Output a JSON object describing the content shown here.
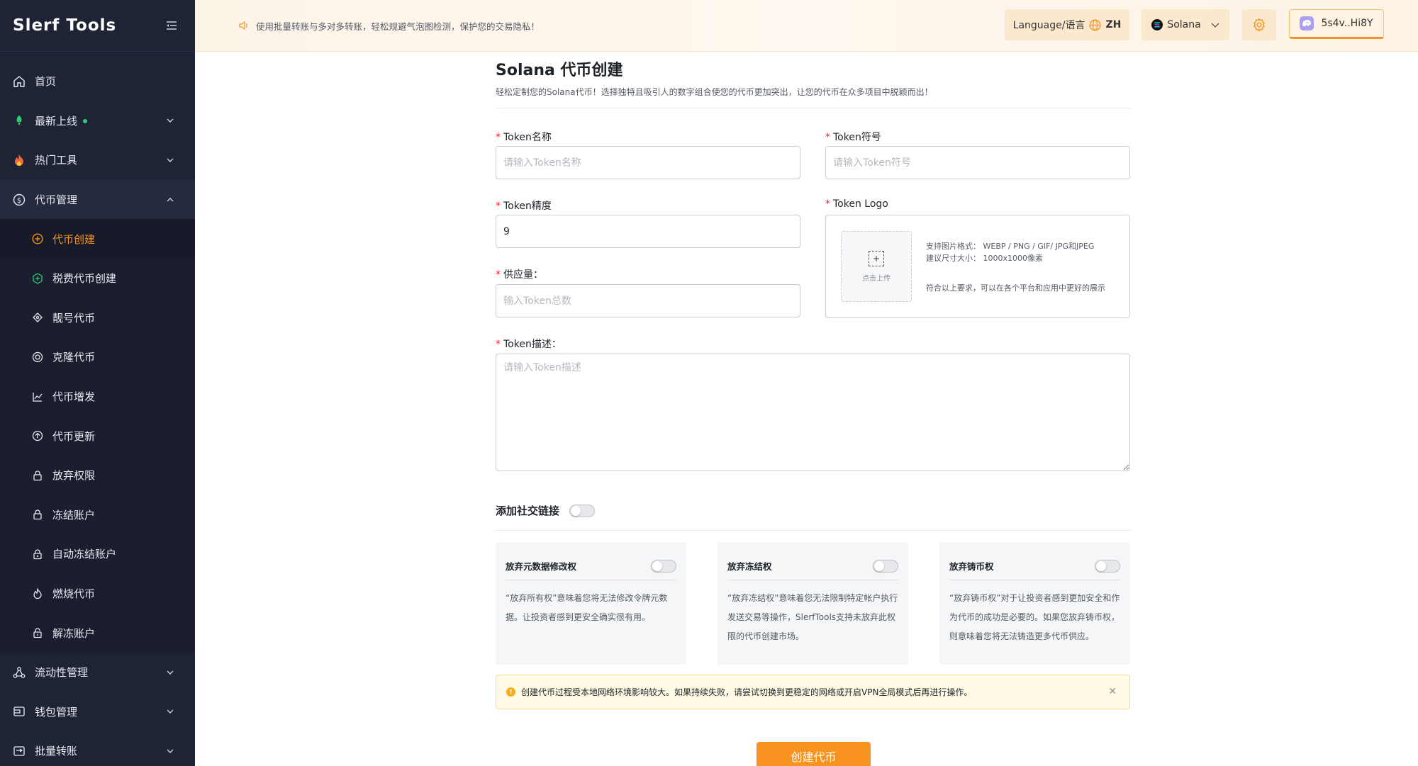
{
  "sidebar": {
    "logo": "Slerf Tools",
    "items": [
      {
        "label": "首页",
        "icon": "home-icon"
      },
      {
        "label": "最新上线",
        "icon": "rocket-icon",
        "badge": true
      },
      {
        "label": "热门工具",
        "icon": "fire-icon"
      },
      {
        "label": "代币管理",
        "icon": "coin-icon",
        "open": true
      },
      {
        "label": "流动性管理",
        "icon": "network-icon"
      },
      {
        "label": "钱包管理",
        "icon": "wallet-icon"
      },
      {
        "label": "批量转账",
        "icon": "transfer-icon"
      }
    ],
    "sub_items": [
      {
        "label": "代币创建",
        "icon": "plus-circle-icon",
        "active": true
      },
      {
        "label": "税费代币创建",
        "icon": "tax-icon"
      },
      {
        "label": "靓号代币",
        "icon": "diamond-icon"
      },
      {
        "label": "克隆代币",
        "icon": "clone-icon"
      },
      {
        "label": "代币增发",
        "icon": "chart-up-icon"
      },
      {
        "label": "代币更新",
        "icon": "arrow-up-circle-icon"
      },
      {
        "label": "放弃权限",
        "icon": "lock-icon"
      },
      {
        "label": "冻结账户",
        "icon": "lock-icon"
      },
      {
        "label": "自动冻结账户",
        "icon": "auto-lock-icon"
      },
      {
        "label": "燃烧代币",
        "icon": "flame-icon"
      },
      {
        "label": "解冻账户",
        "icon": "unlock-icon"
      }
    ]
  },
  "header": {
    "notice": "使用批量转账与多对多转账，轻松规避气泡图检测，保护您的交易隐私！",
    "language_label": "Language/语言",
    "language_code": "ZH",
    "chain": "Solana",
    "wallet": "5s4v..Hi8Y"
  },
  "main": {
    "title": "Solana 代币创建",
    "subtitle": "轻松定制您的Solana代币！选择独特且吸引人的数字组合使您的代币更加突出，让您的代币在众多项目中脱颖而出！",
    "fields": {
      "name_label": "Token名称",
      "name_placeholder": "请输入Token名称",
      "symbol_label": "Token符号",
      "symbol_placeholder": "请输入Token符号",
      "decimals_label": "Token精度",
      "decimals_value": "9",
      "supply_label": "供应量：",
      "supply_placeholder": "输入Token总数",
      "logo_label": "Token Logo",
      "desc_label": "Token描述：",
      "desc_placeholder": "请输入Token描述"
    },
    "logo": {
      "upload_label": "点击上传",
      "format_line": "支持图片格式： WEBP / PNG / GIF/ JPG和JPEG",
      "size_line": "建议尺寸大小： 1000x1000像素",
      "note_line": "符合以上要求，可以在各个平台和应用中更好的展示"
    },
    "social_title": "添加社交链接",
    "cards": [
      {
        "title": "放弃元数据修改权",
        "body": "“放弃所有权”意味着您将无法修改令牌元数据。让投资者感到更安全确实很有用。"
      },
      {
        "title": "放弃冻结权",
        "body": "“放弃冻结权”意味着您无法限制特定帐户执行发送交易等操作，SlerfTools支持未放弃此权限的代币创建市场。"
      },
      {
        "title": "放弃铸币权",
        "body": "“放弃铸币权”对于让投资者感到更加安全和作为代币的成功是必要的。如果您放弃铸币权，则意味着您将无法铸造更多代币供应。"
      }
    ],
    "alert": "创建代币过程受本地网络环境影响较大。如果持续失败，请尝试切换到更稳定的网络或开启VPN全局模式后再进行操作。",
    "create_button": "创建代币"
  },
  "colors": {
    "accent": "#f7931e",
    "sidebar_bg": "#1f2336",
    "required": "#f5222d"
  }
}
